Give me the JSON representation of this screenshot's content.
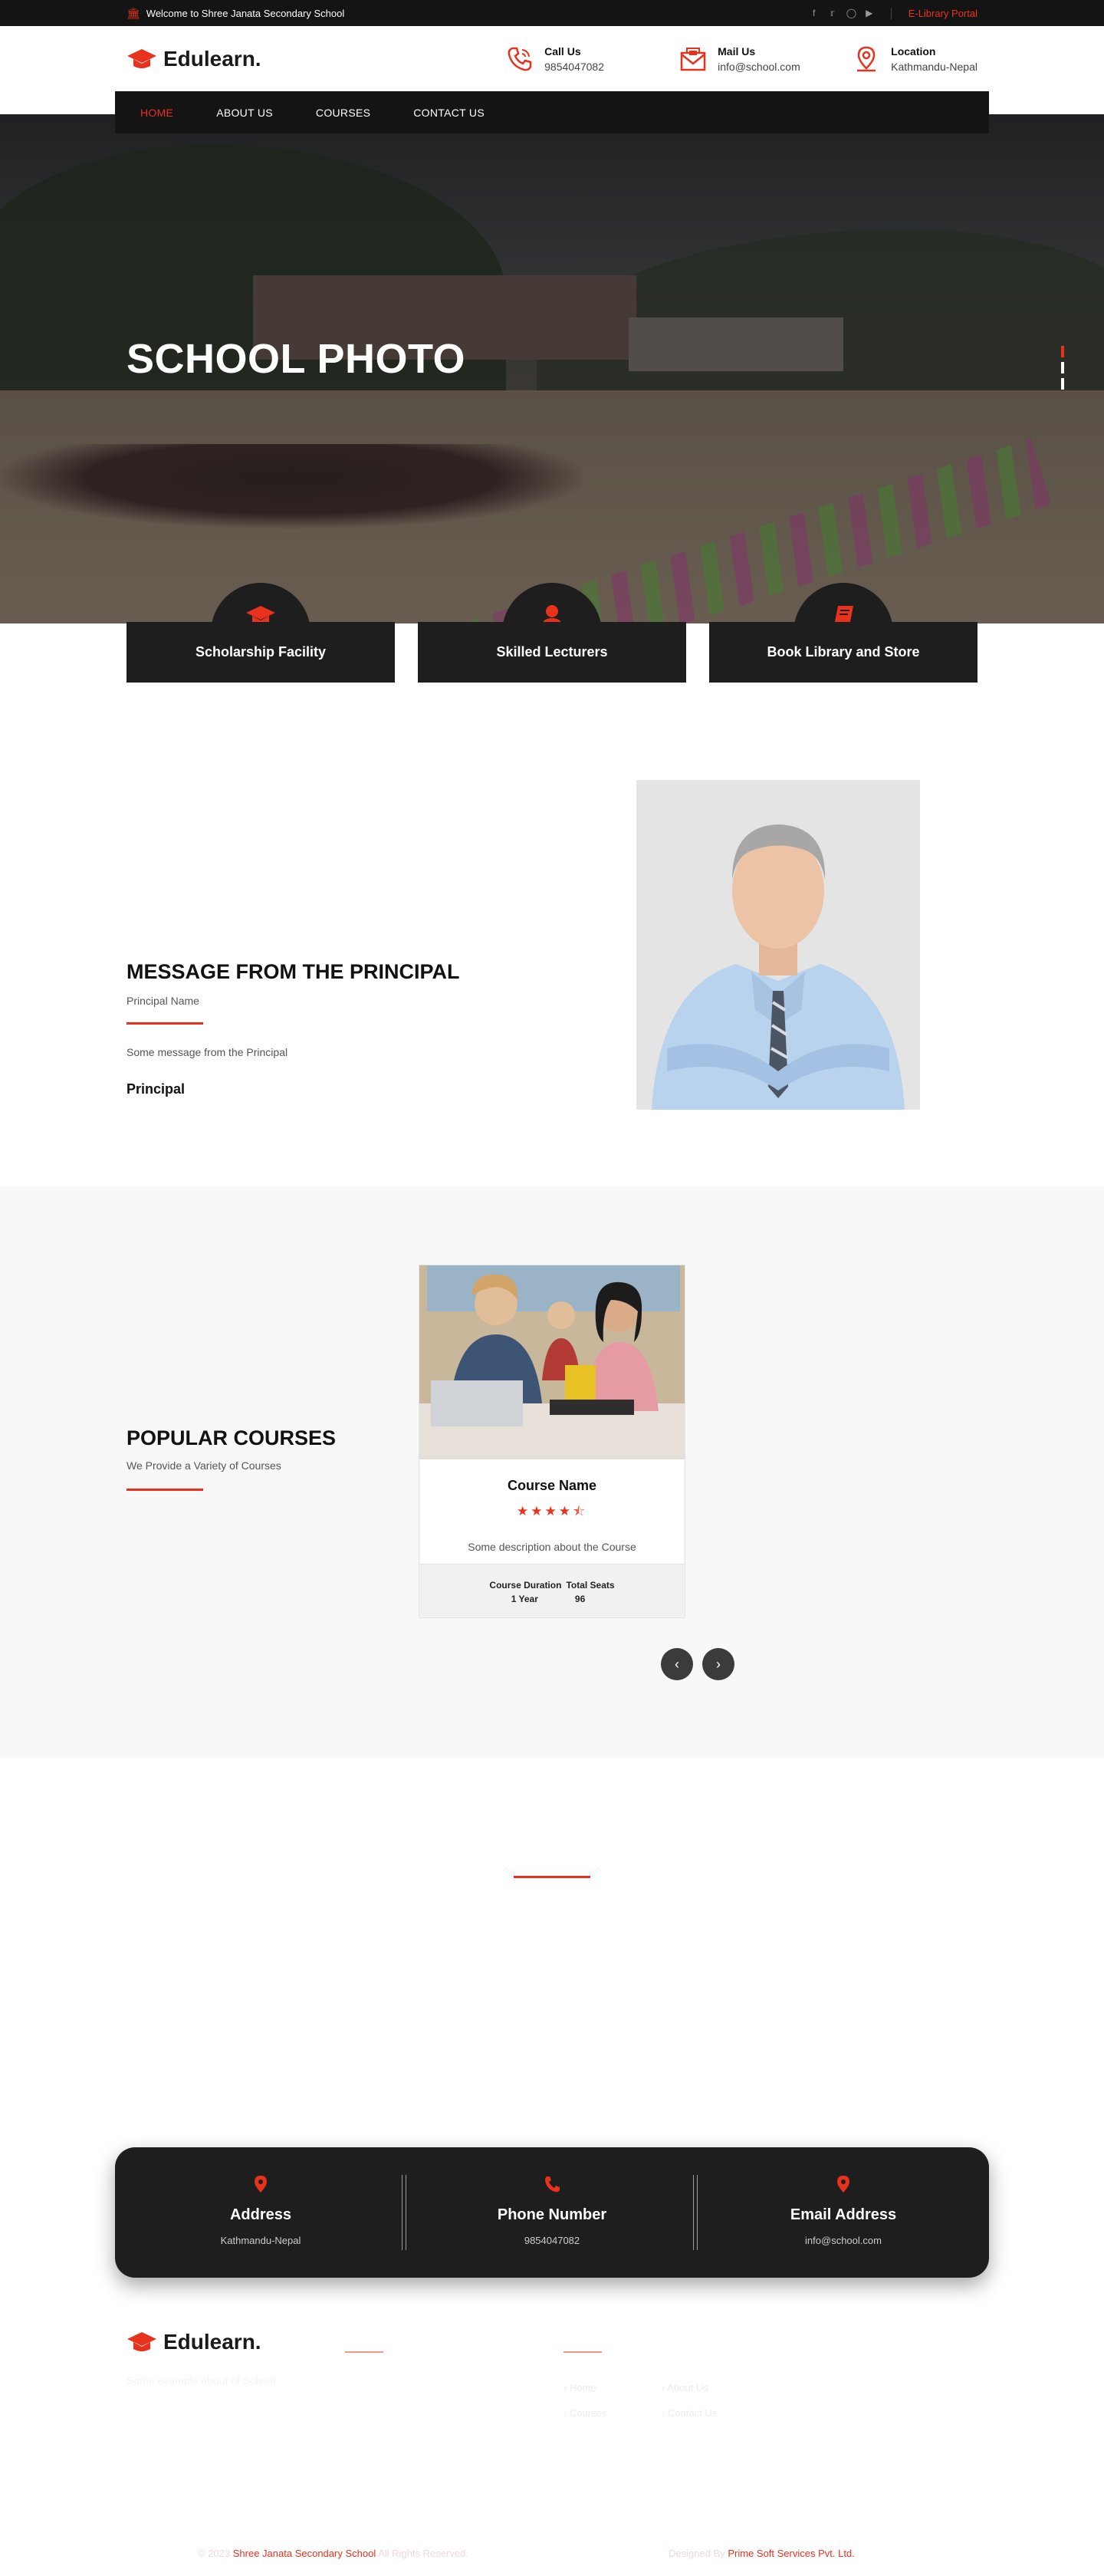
{
  "topbar": {
    "welcome": "Welcome to Shree Janata Secondary School",
    "social_icons": [
      "facebook-icon",
      "twitter-icon",
      "instagram-icon",
      "youtube-icon"
    ],
    "portal_link": "E-Library Portal"
  },
  "header": {
    "logo": "Edulearn.",
    "contacts": [
      {
        "title": "Call Us",
        "value": "9854047082",
        "icon": "phone-icon"
      },
      {
        "title": "Mail Us",
        "value": "info@school.com",
        "icon": "mail-icon"
      },
      {
        "title": "Location",
        "value": "Kathmandu-Nepal",
        "icon": "location-icon"
      }
    ]
  },
  "nav": {
    "items": [
      {
        "label": "HOME",
        "active": true
      },
      {
        "label": "ABOUT US",
        "active": false
      },
      {
        "label": "COURSES",
        "active": false
      },
      {
        "label": "CONTACT US",
        "active": false
      }
    ]
  },
  "hero": {
    "title": "SCHOOL PHOTO",
    "slide_count": 3,
    "active_slide": 1
  },
  "features": [
    {
      "label": "Scholarship Facility",
      "icon": "graduation-cap-icon"
    },
    {
      "label": "Skilled Lecturers",
      "icon": "user-icon"
    },
    {
      "label": "Book Library and Store",
      "icon": "book-icon"
    }
  ],
  "principal": {
    "heading": "MESSAGE FROM THE PRINCIPAL",
    "name": "Principal Name",
    "message": "Some message from the Principal",
    "signature": "Principal"
  },
  "courses": {
    "heading": "POPULAR COURSES",
    "subheading": "We Provide a Variety of Courses",
    "card": {
      "title": "Course Name",
      "rating": 4.5,
      "description": "Some description about the Course",
      "duration_label": "Course Duration",
      "seats_label": "Total Seats",
      "duration": "1 Year",
      "seats": "96"
    }
  },
  "contact_band": [
    {
      "title": "Address",
      "value": "Kathmandu-Nepal",
      "icon": "location-icon"
    },
    {
      "title": "Phone Number",
      "value": "9854047082",
      "icon": "phone-icon"
    },
    {
      "title": "Email Address",
      "value": "info@school.com",
      "icon": "location-icon"
    }
  ],
  "footer": {
    "logo": "Edulearn.",
    "description": "Some example about of School",
    "links": [
      "Home",
      "About Us",
      "Courses",
      "Contact Us"
    ],
    "copyright_prefix": "© 2023",
    "school_name": "Shree Janata Secondary School",
    "rights": "All Rights Reserved.",
    "designed_by": "Designed By",
    "designer": "Prime Soft Services Pvt. Ltd."
  },
  "colors": {
    "accent": "#e8321e",
    "dark": "#1e1e1e",
    "topbar": "#141414"
  }
}
